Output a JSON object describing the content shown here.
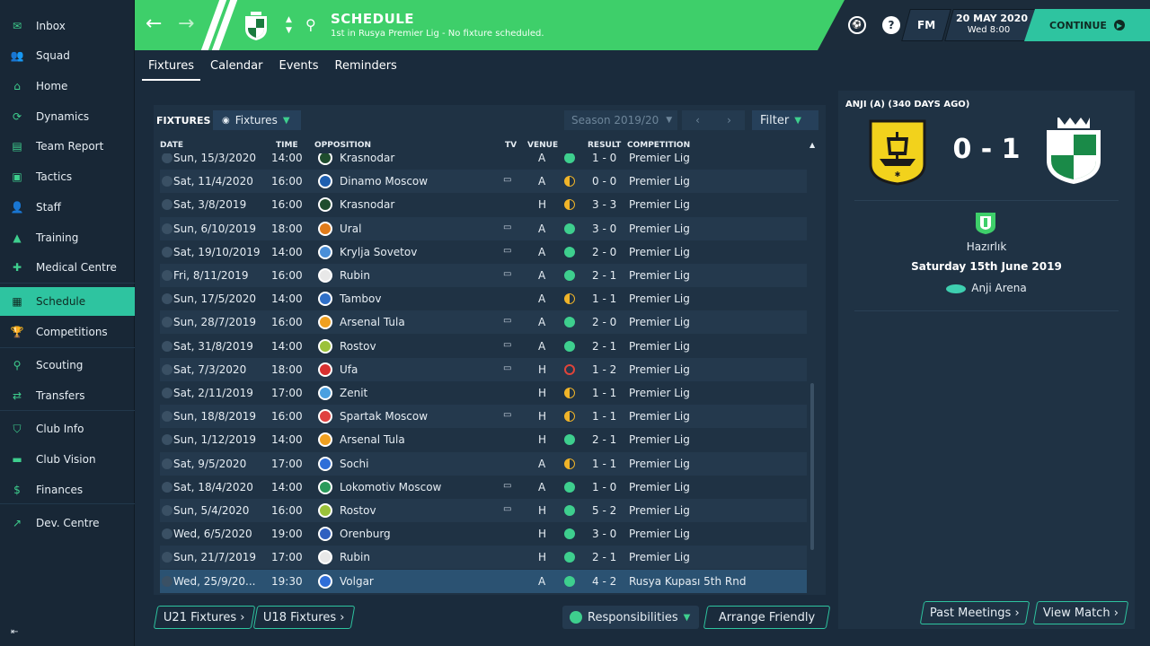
{
  "sidebar": {
    "items": [
      {
        "label": "Inbox",
        "icon": "inbox-icon"
      },
      {
        "label": "Squad",
        "icon": "squad-icon"
      },
      {
        "label": "Home",
        "icon": "home-icon"
      },
      {
        "label": "Dynamics",
        "icon": "dynamics-icon"
      },
      {
        "label": "Team Report",
        "icon": "report-icon"
      },
      {
        "label": "Tactics",
        "icon": "tactics-icon"
      },
      {
        "label": "Staff",
        "icon": "staff-icon"
      },
      {
        "label": "Training",
        "icon": "training-icon"
      },
      {
        "label": "Medical Centre",
        "icon": "medical-icon"
      },
      {
        "label": "Schedule",
        "icon": "calendar-icon"
      },
      {
        "label": "Competitions",
        "icon": "trophy-icon"
      },
      {
        "label": "Scouting",
        "icon": "search-icon"
      },
      {
        "label": "Transfers",
        "icon": "transfer-icon"
      },
      {
        "label": "Club Info",
        "icon": "shield-icon"
      },
      {
        "label": "Club Vision",
        "icon": "briefcase-icon"
      },
      {
        "label": "Finances",
        "icon": "money-icon"
      },
      {
        "label": "Dev. Centre",
        "icon": "chart-icon"
      }
    ],
    "active_index": 9
  },
  "header": {
    "title": "SCHEDULE",
    "subtitle": "1st in Rusya Premier Lig - No fixture scheduled.",
    "date": "20 MAY 2020",
    "time": "Wed 8:00",
    "logo": "FM",
    "continue_label": "CONTINUE",
    "help_glyph": "?"
  },
  "tabs": [
    {
      "label": "Fixtures",
      "active": true
    },
    {
      "label": "Calendar",
      "active": false
    },
    {
      "label": "Events",
      "active": false
    },
    {
      "label": "Reminders",
      "active": false
    }
  ],
  "fixtures": {
    "label": "FIXTURES",
    "view_dropdown": "Fixtures",
    "season": "Season 2019/20",
    "filter_label": "Filter",
    "columns": {
      "date": "DATE",
      "time": "TIME",
      "opposition": "OPPOSITION",
      "tv": "TV",
      "venue": "VENUE",
      "result": "RESULT",
      "competition": "COMPETITION"
    },
    "rows": [
      {
        "date": "Sun, 15/3/2020",
        "time": "14:00",
        "opp": "Krasnodar",
        "tv": false,
        "venue": "A",
        "result": "1 - 0",
        "comp": "Premier Lig",
        "outcome": "W",
        "crest": "#1f4d2e"
      },
      {
        "date": "Sat, 11/4/2020",
        "time": "16:00",
        "opp": "Dinamo Moscow",
        "tv": true,
        "venue": "A",
        "result": "0 - 0",
        "comp": "Premier Lig",
        "outcome": "D",
        "crest": "#1e5fb0"
      },
      {
        "date": "Sat, 3/8/2019",
        "time": "16:00",
        "opp": "Krasnodar",
        "tv": false,
        "venue": "H",
        "result": "3 - 3",
        "comp": "Premier Lig",
        "outcome": "D",
        "crest": "#1f4d2e"
      },
      {
        "date": "Sun, 6/10/2019",
        "time": "18:00",
        "opp": "Ural",
        "tv": true,
        "venue": "A",
        "result": "3 - 0",
        "comp": "Premier Lig",
        "outcome": "W",
        "crest": "#e07b1a"
      },
      {
        "date": "Sat, 19/10/2019",
        "time": "14:00",
        "opp": "Krylja Sovetov",
        "tv": true,
        "venue": "A",
        "result": "2 - 0",
        "comp": "Premier Lig",
        "outcome": "W",
        "crest": "#4a8fd8"
      },
      {
        "date": "Fri, 8/11/2019",
        "time": "16:00",
        "opp": "Rubin",
        "tv": true,
        "venue": "A",
        "result": "2 - 1",
        "comp": "Premier Lig",
        "outcome": "W",
        "crest": "#e8e8e8"
      },
      {
        "date": "Sun, 17/5/2020",
        "time": "14:00",
        "opp": "Tambov",
        "tv": false,
        "venue": "A",
        "result": "1 - 1",
        "comp": "Premier Lig",
        "outcome": "D",
        "crest": "#3070c8"
      },
      {
        "date": "Sun, 28/7/2019",
        "time": "16:00",
        "opp": "Arsenal Tula",
        "tv": true,
        "venue": "A",
        "result": "2 - 0",
        "comp": "Premier Lig",
        "outcome": "W",
        "crest": "#f0a020"
      },
      {
        "date": "Sat, 31/8/2019",
        "time": "14:00",
        "opp": "Rostov",
        "tv": true,
        "venue": "A",
        "result": "2 - 1",
        "comp": "Premier Lig",
        "outcome": "W",
        "crest": "#9bc23a"
      },
      {
        "date": "Sat, 7/3/2020",
        "time": "18:00",
        "opp": "Ufa",
        "tv": true,
        "venue": "H",
        "result": "1 - 2",
        "comp": "Premier Lig",
        "outcome": "L",
        "crest": "#d83030"
      },
      {
        "date": "Sat, 2/11/2019",
        "time": "17:00",
        "opp": "Zenit",
        "tv": false,
        "venue": "H",
        "result": "1 - 1",
        "comp": "Premier Lig",
        "outcome": "D",
        "crest": "#4aa0e0"
      },
      {
        "date": "Sun, 18/8/2019",
        "time": "16:00",
        "opp": "Spartak Moscow",
        "tv": true,
        "venue": "H",
        "result": "1 - 1",
        "comp": "Premier Lig",
        "outcome": "D",
        "crest": "#e04040"
      },
      {
        "date": "Sun, 1/12/2019",
        "time": "14:00",
        "opp": "Arsenal Tula",
        "tv": false,
        "venue": "H",
        "result": "2 - 1",
        "comp": "Premier Lig",
        "outcome": "W",
        "crest": "#f0a020"
      },
      {
        "date": "Sat, 9/5/2020",
        "time": "17:00",
        "opp": "Sochi",
        "tv": false,
        "venue": "A",
        "result": "1 - 1",
        "comp": "Premier Lig",
        "outcome": "D",
        "crest": "#2f6ed8"
      },
      {
        "date": "Sat, 18/4/2020",
        "time": "14:00",
        "opp": "Lokomotiv Moscow",
        "tv": true,
        "venue": "A",
        "result": "1 - 0",
        "comp": "Premier Lig",
        "outcome": "W",
        "crest": "#2a9a5a"
      },
      {
        "date": "Sun, 5/4/2020",
        "time": "16:00",
        "opp": "Rostov",
        "tv": true,
        "venue": "H",
        "result": "5 - 2",
        "comp": "Premier Lig",
        "outcome": "W",
        "crest": "#9bc23a"
      },
      {
        "date": "Wed, 6/5/2020",
        "time": "19:00",
        "opp": "Orenburg",
        "tv": false,
        "venue": "H",
        "result": "3 - 0",
        "comp": "Premier Lig",
        "outcome": "W",
        "crest": "#3060c0"
      },
      {
        "date": "Sun, 21/7/2019",
        "time": "17:00",
        "opp": "Rubin",
        "tv": false,
        "venue": "H",
        "result": "2 - 1",
        "comp": "Premier Lig",
        "outcome": "W",
        "crest": "#e8e8e8"
      },
      {
        "date": "Wed, 25/9/20...",
        "time": "19:30",
        "opp": "Volgar",
        "tv": false,
        "venue": "A",
        "result": "4 - 2",
        "comp": "Rusya Kupası 5th Rnd",
        "outcome": "W",
        "crest": "#2f6ed8"
      }
    ],
    "selected_index": 18
  },
  "bottom": {
    "u21_label": "U21 Fixtures",
    "u18_label": "U18 Fixtures",
    "responsibilities_label": "Responsibilities",
    "arrange_label": "Arrange Friendly",
    "past_meetings_label": "Past Meetings",
    "view_match_label": "View Match"
  },
  "match": {
    "title": "ANJI (A) (340 DAYS AGO)",
    "score": "0 - 1",
    "competition": "Hazırlık",
    "date": "Saturday 15th June 2019",
    "venue": "Anji Arena"
  },
  "colors": {
    "win": "#3ecf8e",
    "draw": "#f0b429",
    "loss": "#e0443a",
    "accent": "#2ec4a0",
    "header_green": "#3ecf6a"
  }
}
